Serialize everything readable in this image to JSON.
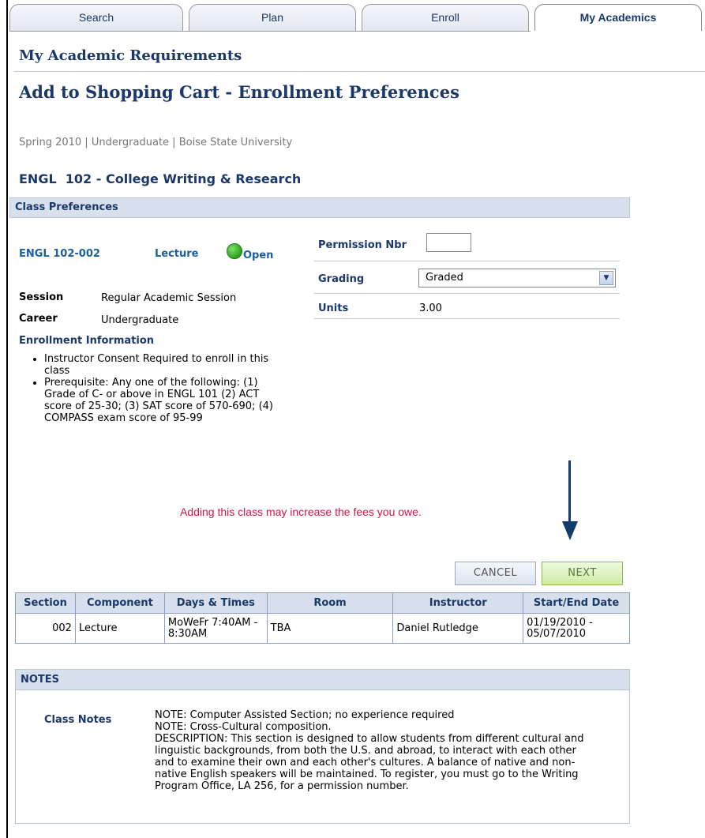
{
  "tabs": [
    {
      "label": "Search"
    },
    {
      "label": "Plan"
    },
    {
      "label": "Enroll"
    },
    {
      "label": "My Academics"
    }
  ],
  "header": {
    "title": "My Academic Requirements",
    "subtitle": "Add to Shopping Cart - Enrollment Preferences",
    "term_line": "Spring 2010 | Undergraduate | Boise State University",
    "course_title": "ENGL  102 - College Writing & Research"
  },
  "class_prefs": {
    "section_title": "Class Preferences",
    "class_id": "ENGL 102-002",
    "component": "Lecture",
    "status": "Open",
    "session_label": "Session",
    "session_value": "Regular Academic Session",
    "career_label": "Career",
    "career_value": "Undergraduate",
    "enroll_info_label": "Enrollment Information",
    "enroll_info": [
      "Instructor Consent Required to enroll in this class",
      "Prerequisite: Any one of the following: (1) Grade of C- or above in ENGL 101 (2) ACT score of 25-30; (3) SAT score of 570-690; (4) COMPASS exam score of 95-99"
    ],
    "permission_label": "Permission Nbr",
    "permission_value": "",
    "grading_label": "Grading",
    "grading_value": "Graded",
    "units_label": "Units",
    "units_value": "3.00"
  },
  "fees_notice": "Adding this class may increase the fees you owe.",
  "buttons": {
    "cancel": "CANCEL",
    "next": "NEXT"
  },
  "sections_table": {
    "headers": [
      "Section",
      "Component",
      "Days & Times",
      "Room",
      "Instructor",
      "Start/End Date"
    ],
    "rows": [
      [
        "002",
        "Lecture",
        "MoWeFr 7:40AM - 8:30AM",
        "TBA",
        "Daniel Rutledge",
        "01/19/2010 - 05/07/2010"
      ]
    ]
  },
  "notes": {
    "section_title": "NOTES",
    "class_notes_label": "Class Notes",
    "class_notes_text": "NOTE: Computer Assisted Section; no experience required\nNOTE:  Cross-Cultural composition.\nDESCRIPTION:  This section is designed to allow students from different cultural and linguistic backgrounds, from both the U.S. and abroad, to interact with each other and to examine their own and each other's cultures.  A balance of native and non-native English speakers will be maintained.  To register, you must go to the Writing Program Office, LA 256, for a permission number."
  },
  "colors": {
    "heading": "#1b3868",
    "link": "#1b5fa0",
    "bar": "#d7e0ec",
    "fees_text": "#d4144a",
    "open_status": "#2ea01b"
  }
}
